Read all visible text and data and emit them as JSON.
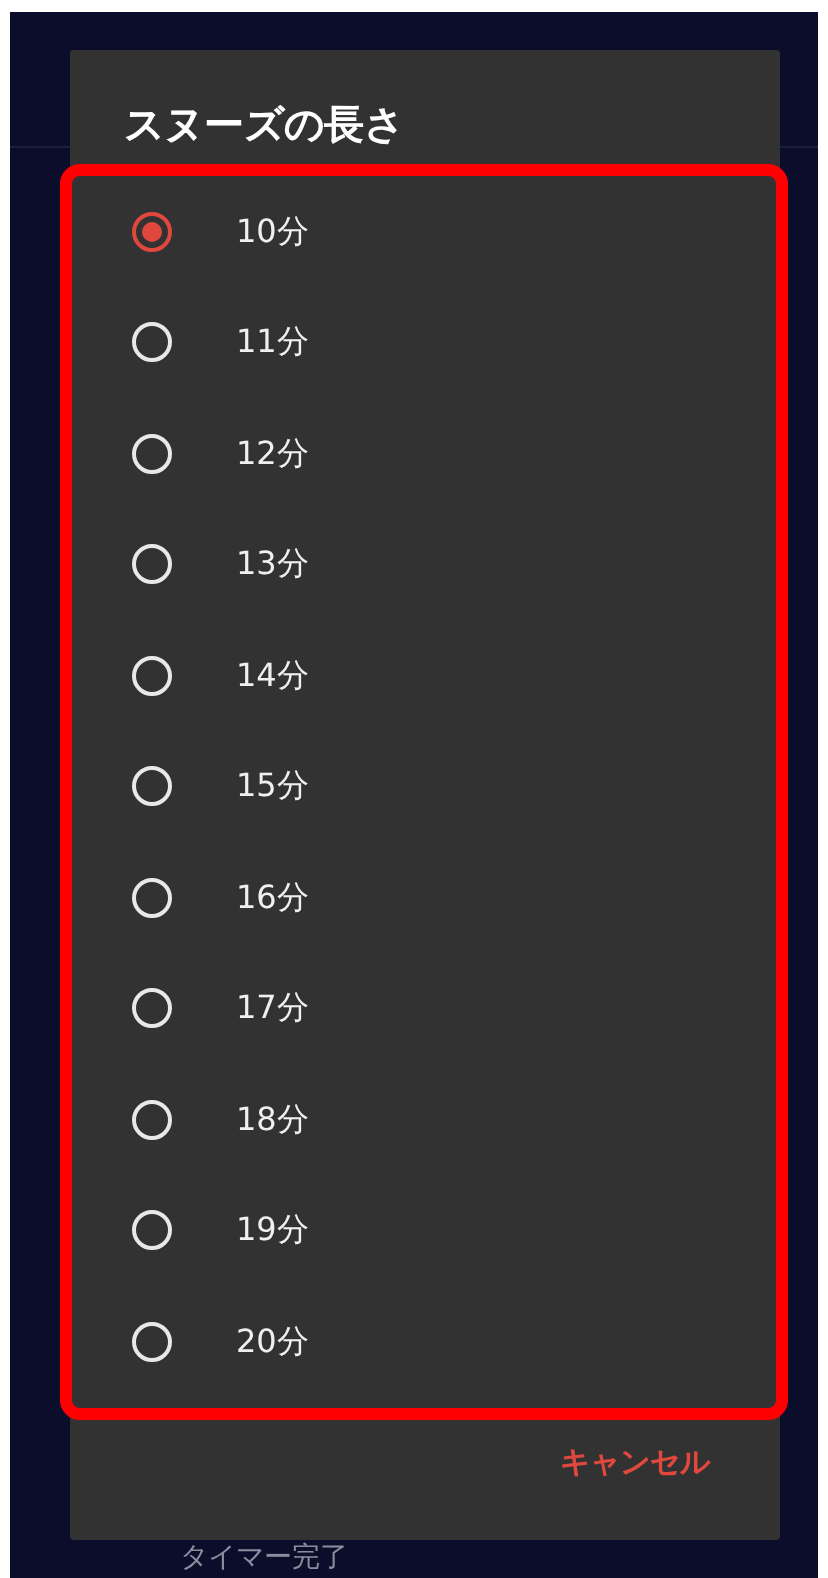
{
  "dialog": {
    "title": "スヌーズの長さ",
    "options": [
      {
        "label": "10分",
        "selected": true
      },
      {
        "label": "11分",
        "selected": false
      },
      {
        "label": "12分",
        "selected": false
      },
      {
        "label": "13分",
        "selected": false
      },
      {
        "label": "14分",
        "selected": false
      },
      {
        "label": "15分",
        "selected": false
      },
      {
        "label": "16分",
        "selected": false
      },
      {
        "label": "17分",
        "selected": false
      },
      {
        "label": "18分",
        "selected": false
      },
      {
        "label": "19分",
        "selected": false
      },
      {
        "label": "20分",
        "selected": false
      }
    ],
    "cancel_button": "キャンセル"
  },
  "background": {
    "caption": "タイマー完了"
  }
}
